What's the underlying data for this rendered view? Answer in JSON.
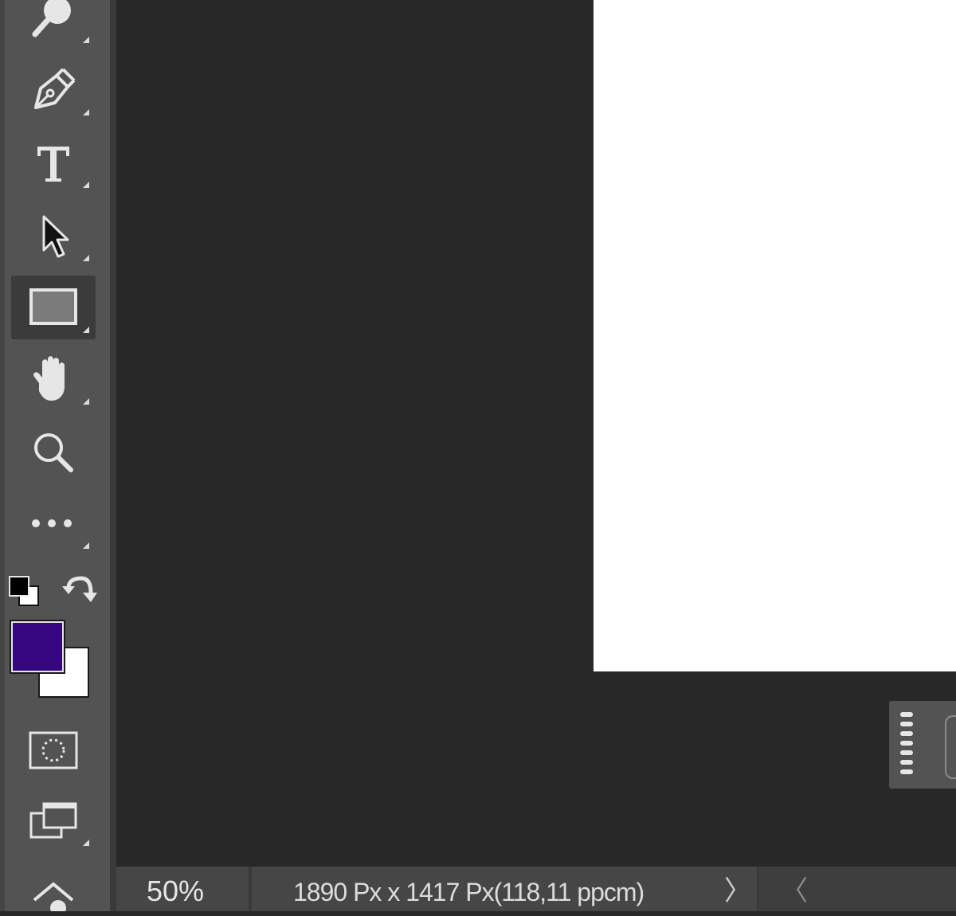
{
  "app": "Photoshop",
  "tools": [
    {
      "id": "spot-healing",
      "icon": "spot-healing-icon"
    },
    {
      "id": "pen",
      "icon": "pen-icon"
    },
    {
      "id": "type",
      "icon": "type-icon"
    },
    {
      "id": "path-selection",
      "icon": "path-selection-arrow-icon"
    },
    {
      "id": "rectangle",
      "icon": "rectangle-icon",
      "active": true
    },
    {
      "id": "hand",
      "icon": "hand-icon"
    },
    {
      "id": "zoom",
      "icon": "zoom-icon"
    },
    {
      "id": "edit-toolbar",
      "icon": "more-dots-icon"
    }
  ],
  "colors": {
    "foreground": "#35077f",
    "background": "#ffffff",
    "canvas_bg": "#282828",
    "toolbar_bg": "#535353"
  },
  "color_controls": {
    "default_colors_icon": "default-colors-icon",
    "swap_colors_icon": "swap-colors-icon"
  },
  "modes": {
    "quick_mask_icon": "quick-mask-icon",
    "screen_mode_icon": "screen-mode-icon"
  },
  "status": {
    "zoom": "50%",
    "doc_info": "1890 Px x 1417 Px(118,11 ppcm)",
    "expand_arrow": "〉",
    "scroll_left": "〈"
  }
}
